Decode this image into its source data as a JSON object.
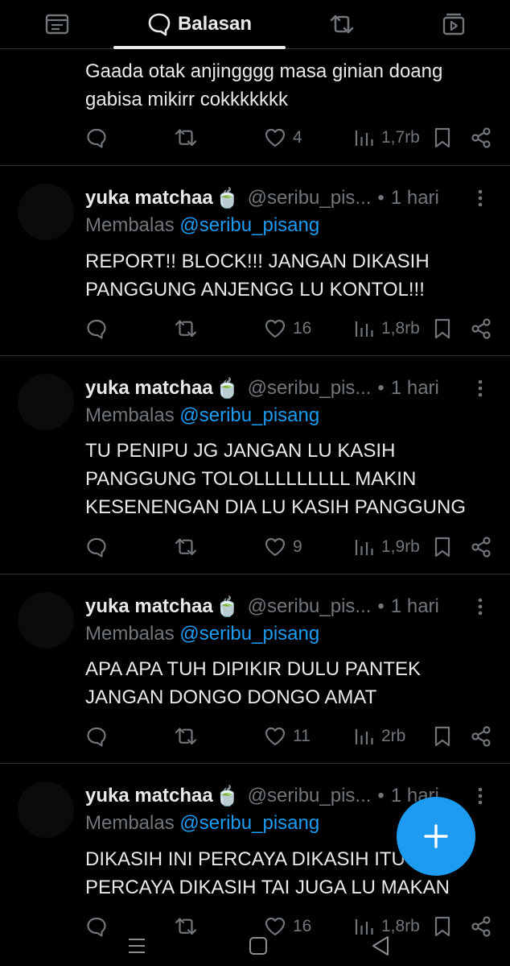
{
  "tabs": [
    {
      "icon": "feed-icon",
      "label": ""
    },
    {
      "icon": "reply-bubble-icon",
      "label": "Balasan"
    },
    {
      "icon": "retweet-icon",
      "label": ""
    },
    {
      "icon": "media-icon",
      "label": ""
    }
  ],
  "tweets": [
    {
      "author": "",
      "emoji": "",
      "handle": "",
      "time": "",
      "replying_prefix": "",
      "replying_to": "",
      "text": "Gaada otak anjingggg masa ginian doang\ngabisa mikirr cokkkkkkk",
      "likes": "4",
      "views": "1,7rb"
    },
    {
      "author": "yuka matchaa",
      "emoji": "🍵",
      "handle": "@seribu_pis...",
      "time": "1 hari",
      "replying_prefix": "Membalas",
      "replying_to": "@seribu_pisang",
      "text": "REPORT!! BLOCK!!!  JANGAN DIKASIH\nPANGGUNG ANJENGG LU KONTOL!!!",
      "likes": "16",
      "views": "1,8rb"
    },
    {
      "author": "yuka matchaa",
      "emoji": "🍵",
      "handle": "@seribu_pis...",
      "time": "1 hari",
      "replying_prefix": "Membalas",
      "replying_to": "@seribu_pisang",
      "text": "TU PENIPU JG JANGAN LU KASIH\nPANGGUNG TOLOLLLLLLLLL MAKIN\nKESENENGAN DIA LU KASIH PANGGUNG",
      "likes": "9",
      "views": "1,9rb"
    },
    {
      "author": "yuka matchaa",
      "emoji": "🍵",
      "handle": "@seribu_pis...",
      "time": "1 hari",
      "replying_prefix": "Membalas",
      "replying_to": "@seribu_pisang",
      "text": "APA APA TUH DIPIKIR DULU PANTEK\nJANGAN DONGO DONGO AMAT",
      "likes": "11",
      "views": "2rb"
    },
    {
      "author": "yuka matchaa",
      "emoji": "🍵",
      "handle": "@seribu_pis...",
      "time": "1 hari",
      "replying_prefix": "Membalas",
      "replying_to": "@seribu_pisang",
      "text": "DIKASIH INI PERCAYA DIKASIH ITU\nPERCAYA DIKASIH TAI JUGA LU MAKAN",
      "likes": "16",
      "views": "1,8rb"
    }
  ],
  "compose_button": {
    "icon": "plus-icon"
  },
  "system_nav": [
    "recent-apps-icon",
    "home-icon",
    "back-icon"
  ],
  "colors": {
    "accent": "#1d9bf0",
    "background": "#000000",
    "text": "#e7e9ea",
    "muted": "#71767b",
    "divider": "#2f3336"
  }
}
